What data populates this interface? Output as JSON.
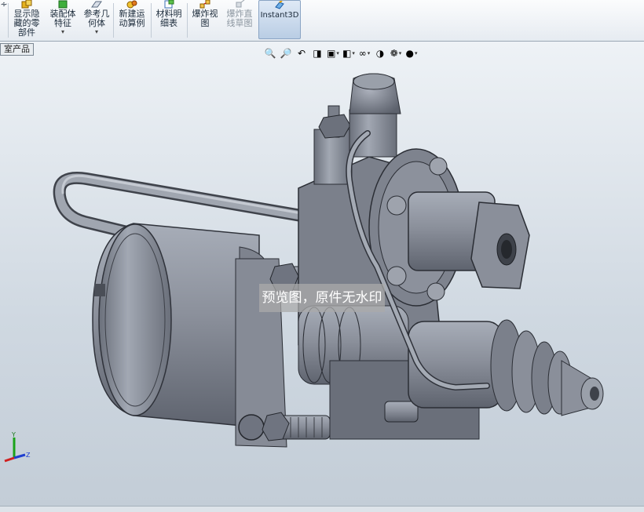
{
  "ribbon": {
    "partial_label": "∻",
    "show_hidden": "显示隐藏的零部件",
    "assembly_feature": "装配体特征",
    "reference_geometry": "参考几何体",
    "new_motion_study": "新建运动算例",
    "bill_of_materials": "材料明细表",
    "exploded_view": "爆炸视图",
    "explode_line_sketch": "爆炸直线草图",
    "instant3d": "Instant3D"
  },
  "tree_tab": "室产品",
  "viewport": {
    "watermark": "预览图，原件无水印"
  },
  "triad": {
    "y": "Y",
    "z": "Z"
  },
  "colors": {
    "metal": "#8e939e",
    "dark_metal": "#5f6470",
    "background": "#c9d3dd",
    "accent": "#1f6fd0"
  },
  "view_toolbar": [
    "zoom-to-fit-icon",
    "zoom-area-icon",
    "previous-view-icon",
    "section-view-icon",
    "view-orientation-icon",
    "display-style-icon",
    "hide-show-icon",
    "edit-appearance-icon",
    "apply-scene-icon",
    "view-settings-icon"
  ]
}
